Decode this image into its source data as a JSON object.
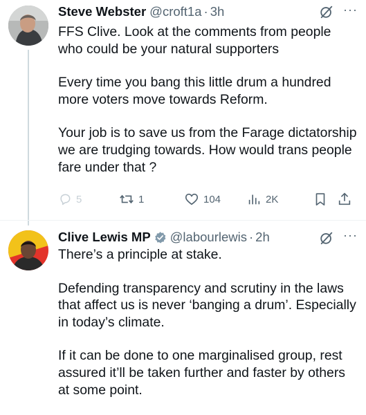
{
  "reply_tweet": {
    "author_name": "Steve Webster",
    "author_handle": "@croft1a",
    "time": "3h",
    "dot": "·",
    "more_label": "···",
    "paragraphs": [
      "FFS Clive. Look at the comments from people who could be your natural supporters",
      "Every time you bang this little drum a hundred more voters move towards Reform.",
      "Your job is to save us from the Farage dictatorship we are trudging towards. How would trans people fare under that ?"
    ],
    "actions": {
      "replies": "5",
      "reposts": "1",
      "likes": "104",
      "views": "2K"
    }
  },
  "main_tweet": {
    "author_name": "Clive Lewis MP",
    "author_handle": "@labourlewis",
    "time": "2h",
    "dot": "·",
    "more_label": "···",
    "verified": true,
    "paragraphs": [
      "There’s a principle at stake.",
      "Defending transparency and scrutiny in the laws that affect us is never ‘banging a drum’. Especially in today’s climate.",
      "If it can be done to one marginalised group, rest assured it’ll be taken further and faster by others at some point."
    ]
  },
  "colors": {
    "text": "#0f1419",
    "secondary": "#536471",
    "thread_line": "#cfd9de",
    "verified_badge": "#829aab"
  }
}
